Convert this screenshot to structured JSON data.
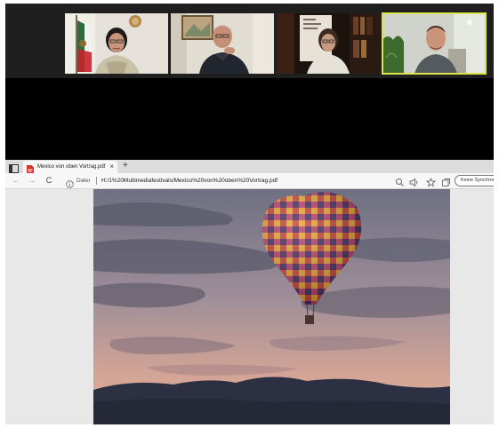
{
  "meeting": {
    "participants": [
      {
        "id": "p1",
        "active": false
      },
      {
        "id": "p2",
        "active": false
      },
      {
        "id": "p3",
        "active": false
      },
      {
        "id": "p4",
        "active": true
      }
    ]
  },
  "browser": {
    "tab": {
      "title": "Mexico von oben Vortrag.pdf",
      "icon": "pdf-file-icon",
      "close": "×"
    },
    "new_tab": "+",
    "nav": {
      "back": "←",
      "forward": "→",
      "reload": "C"
    },
    "address": {
      "site_label": "Datei",
      "url": "H:/1%20Multimediafestivals/Mexico%20von%20oben%20Vortrag.pdf"
    },
    "sync_button": "Keine Synchronisierung",
    "icons": [
      "zoom-icon",
      "read-aloud-icon",
      "favorites-icon",
      "collections-icon"
    ]
  },
  "document": {
    "image_subject": "hot-air-balloon-at-dusk"
  },
  "colors": {
    "sky_top": "#6f7183",
    "sky_bottom": "#d8a697",
    "hills": "#2c3143",
    "active_speaker": "#d9e64a"
  }
}
